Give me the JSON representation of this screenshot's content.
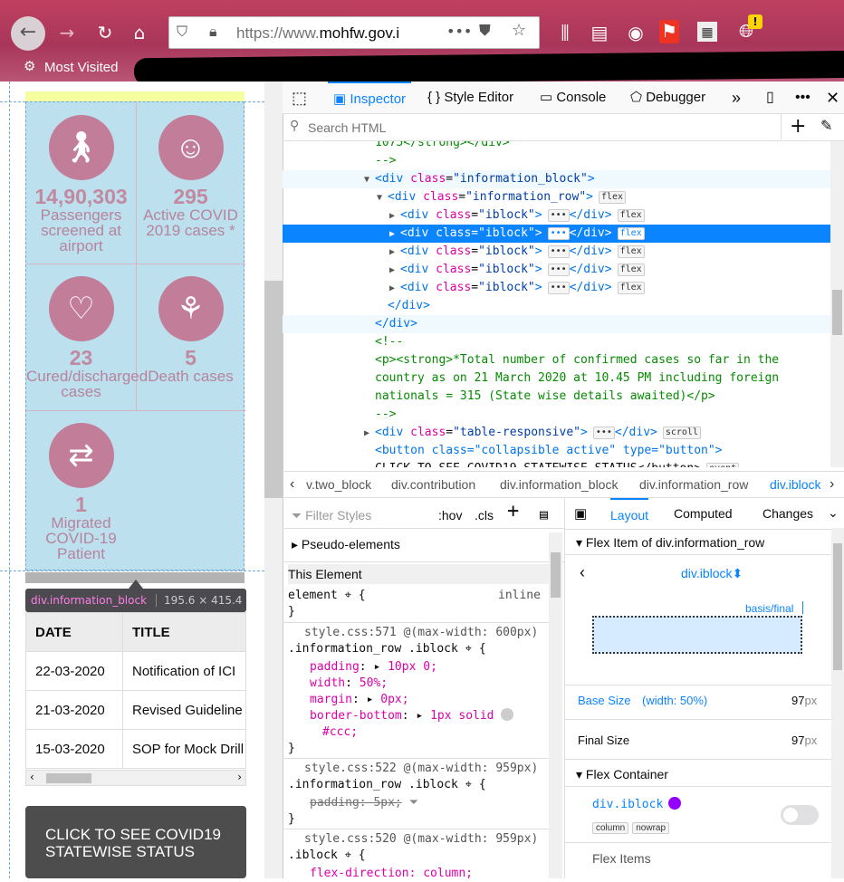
{
  "browser": {
    "url_prefix": "https://www.",
    "url_domain": "mohfw.gov.i",
    "bookmark": "Most Visited"
  },
  "page": {
    "stats": [
      {
        "number": "14,90,303",
        "label1": "Passengers",
        "label2": "screened at",
        "label3": "airport",
        "icon": "walking-passenger-icon"
      },
      {
        "number": "295",
        "label1": "Active COVID",
        "label2": "2019 cases *",
        "label3": "",
        "icon": "virus-person-icon"
      },
      {
        "number": "23",
        "label1": "Cured/discharged",
        "label2": "cases",
        "label3": "",
        "icon": "heartbeat-icon"
      },
      {
        "number": "5",
        "label1": "Death cases",
        "label2": "",
        "label3": "",
        "icon": "rose-icon"
      },
      {
        "number": "1",
        "label1": "Migrated",
        "label2": "COVID-19",
        "label3": "Patient",
        "icon": "migration-icon"
      }
    ],
    "tooltip": {
      "element": "div.information_block",
      "size": "195.6 × 415.4"
    },
    "table": {
      "headers": [
        "DATE",
        "TITLE"
      ],
      "rows": [
        [
          "22-03-2020",
          "Notification of ICI"
        ],
        [
          "21-03-2020",
          "Revised Guideline"
        ],
        [
          "15-03-2020",
          "SOP for Mock Drill"
        ]
      ]
    },
    "cta_line1": "CLICK TO SEE COVID19",
    "cta_line2": "STATEWISE STATUS"
  },
  "devtools": {
    "tabs": [
      "Inspector",
      "Style Editor",
      "Console",
      "Debugger"
    ],
    "search_placeholder": "Search HTML",
    "markup": [
      {
        "indent": 0,
        "html": "1075</strong></div>",
        "kind": "text"
      },
      {
        "indent": 0,
        "html": "-->",
        "kind": "comment"
      },
      {
        "indent": 0,
        "tag": "div",
        "cls": "information_block",
        "open": true,
        "hov": true
      },
      {
        "indent": 1,
        "tag": "div",
        "cls": "information_row",
        "open": true,
        "badge": "flex"
      },
      {
        "indent": 2,
        "tag": "div",
        "cls": "iblock",
        "collapsed": true,
        "badge": "flex"
      },
      {
        "indent": 2,
        "tag": "div",
        "cls": "iblock",
        "collapsed": true,
        "badge": "flex",
        "selected": true
      },
      {
        "indent": 2,
        "tag": "div",
        "cls": "iblock",
        "collapsed": true,
        "badge": "flex"
      },
      {
        "indent": 2,
        "tag": "div",
        "cls": "iblock",
        "collapsed": true,
        "badge": "flex"
      },
      {
        "indent": 2,
        "tag": "div",
        "cls": "iblock",
        "collapsed": true,
        "badge": "flex"
      },
      {
        "indent": 1,
        "close": "</div>"
      },
      {
        "indent": 0,
        "close": "</div>",
        "hov": true
      },
      {
        "indent": 0,
        "html": "<!--",
        "kind": "comment"
      },
      {
        "indent": 0,
        "html": "<p><strong>*Total number of confirmed cases so far in the",
        "kind": "comment"
      },
      {
        "indent": 0,
        "html": "country as on 21 March 2020 at 10.45 PM including foreign",
        "kind": "comment"
      },
      {
        "indent": 0,
        "html": "nationals = 315 (State wise details awaited)</p>",
        "kind": "comment"
      },
      {
        "indent": 0,
        "html": "-->",
        "kind": "comment"
      },
      {
        "indent": 0,
        "tag": "div",
        "cls": "table-responsive",
        "collapsed": true,
        "badge": "scroll",
        "twisty": true
      },
      {
        "indent": 0,
        "html": "<button class=\"collapsible active\" type=\"button\">",
        "kind": "button"
      },
      {
        "indent": 0,
        "html": "CLICK TO SEE COVID19 STATEWISE STATUS</button>",
        "kind": "buttontext",
        "badge": "event"
      }
    ],
    "breadcrumbs": [
      "v.two_block",
      "div.contribution",
      "div.information_block",
      "div.information_row",
      "div.iblock"
    ],
    "rules": {
      "filter_placeholder": "Filter Styles",
      "hov": ":hov",
      "cls": ".cls",
      "pseudo": "Pseudo-elements",
      "this_element": "This Element",
      "element_line": "element",
      "inline": "inline",
      "src1": "style.css:571 @(max-width: 600px)",
      "sel1": ".information_row .iblock",
      "decl1": [
        [
          "padding",
          "10px 0;"
        ],
        [
          "width",
          "50%;"
        ],
        [
          "margin",
          "0px;"
        ],
        [
          "border-bottom",
          "1px solid"
        ]
      ],
      "decl1_cont": "#ccc;",
      "src2": "style.css:522 @(max-width: 959px)",
      "sel2": ".information_row .iblock",
      "decl2": "padding: 5px;",
      "src3": "style.css:520 @(max-width: 959px)",
      "sel3": ".iblock",
      "decl3": "flex-direction: column;"
    },
    "layout": {
      "tabs": [
        "Layout",
        "Computed",
        "Changes"
      ],
      "flex_item_header": "Flex Item of div.information_row",
      "selector": "div.iblock",
      "basis_label": "basis/final",
      "base_size_label": "Base Size",
      "base_size_note": "(width: 50%)",
      "base_size_value": "97",
      "final_size_label": "Final Size",
      "final_size_value": "97",
      "unit": "px",
      "flex_container_header": "Flex Container",
      "container_selector": "div.iblock",
      "pills": [
        "column",
        "nowrap"
      ],
      "flex_items": "Flex Items"
    }
  }
}
